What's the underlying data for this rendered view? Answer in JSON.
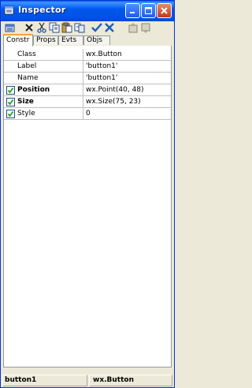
{
  "window": {
    "title": "Inspector"
  },
  "toolbar": {
    "tools": [
      {
        "icon": "inspector-icon"
      },
      {
        "icon": "delete-icon"
      },
      {
        "icon": "cut-icon"
      },
      {
        "icon": "copy-icon"
      },
      {
        "icon": "paste-icon"
      },
      {
        "icon": "duplicate-icon"
      },
      {
        "icon": "apply-check-icon"
      },
      {
        "icon": "cancel-x-icon"
      },
      {
        "icon": "move-up-icon"
      },
      {
        "icon": "move-down-icon"
      }
    ]
  },
  "tabs": [
    {
      "label": "Constr",
      "active": true
    },
    {
      "label": "Props",
      "active": false
    },
    {
      "label": "Evts",
      "active": false
    },
    {
      "label": "Objs",
      "active": false
    }
  ],
  "properties": [
    {
      "name": "Class",
      "value": "wx.Button",
      "checkbox": false,
      "bold": false
    },
    {
      "name": "Label",
      "value": "'button1'",
      "checkbox": false,
      "bold": false
    },
    {
      "name": "Name",
      "value": "'button1'",
      "checkbox": false,
      "bold": false
    },
    {
      "name": "Position",
      "value": "wx.Point(40, 48)",
      "checkbox": true,
      "bold": true
    },
    {
      "name": "Size",
      "value": "wx.Size(75, 23)",
      "checkbox": true,
      "bold": true
    },
    {
      "name": "Style",
      "value": "0",
      "checkbox": true,
      "bold": false
    }
  ],
  "status": {
    "left": "button1",
    "right": "wx.Button"
  },
  "colors": {
    "title_bar": "#0058ee",
    "window_bg": "#ece9d8",
    "active_tab_accent": "#f3a43b",
    "check": "#21a121"
  }
}
